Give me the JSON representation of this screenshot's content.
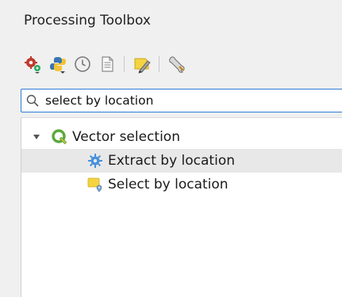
{
  "panel": {
    "title": "Processing Toolbox"
  },
  "toolbar": {
    "items": [
      {
        "icon": "models-gear-icon"
      },
      {
        "icon": "python-scripts-icon"
      },
      {
        "icon": "history-clock-icon"
      },
      {
        "icon": "results-viewer-icon"
      },
      {
        "icon": "edit-features-in-place-icon"
      },
      {
        "icon": "options-wrench-icon"
      }
    ]
  },
  "search": {
    "value": "select by location",
    "icon": "search-icon"
  },
  "tree": {
    "group": {
      "label": "Vector selection",
      "icon": "qgis-logo-icon",
      "expanded": true
    },
    "items": [
      {
        "label": "Extract by location",
        "icon": "gear-algorithm-icon",
        "selected": true
      },
      {
        "label": "Select by location",
        "icon": "select-by-location-icon",
        "selected": false
      }
    ]
  },
  "colors": {
    "focus_border": "#2f7cd7",
    "selection": "#e8e8e8",
    "qgis_green": "#5ba83c",
    "gear_blue": "#4a90d9",
    "select_yellow": "#f5d442"
  }
}
